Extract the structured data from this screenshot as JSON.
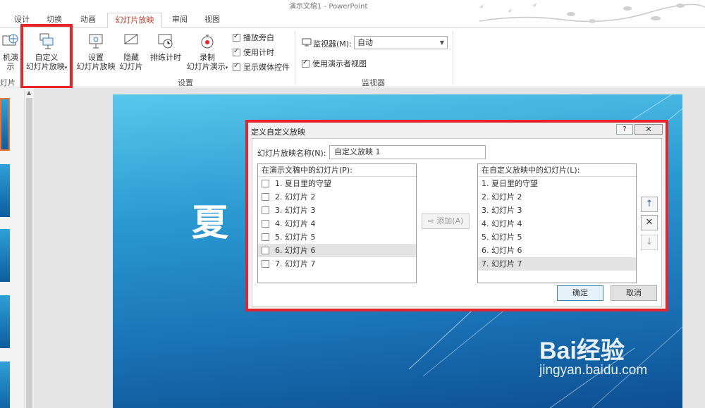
{
  "window": {
    "title": "演示文稿1 - PowerPoint"
  },
  "tabs": [
    {
      "label": "设计"
    },
    {
      "label": "切换"
    },
    {
      "label": "动画"
    },
    {
      "label": "幻灯片放映",
      "active": true
    },
    {
      "label": "审阅"
    },
    {
      "label": "视图"
    }
  ],
  "ribbon": {
    "online_btn_label": "机演示",
    "group_start_label": "灯片",
    "custom_show_btn": {
      "line1": "自定义",
      "line2": "幻灯片放映"
    },
    "setup_btn": {
      "line1": "设置",
      "line2": "幻灯片放映"
    },
    "hide_btn": {
      "line1": "隐藏",
      "line2": "幻灯片"
    },
    "rehearse_btn": {
      "line1": "排练计时"
    },
    "record_btn": {
      "line1": "录制",
      "line2": "幻灯片演示"
    },
    "checks": [
      {
        "label": "播放旁白",
        "checked": true
      },
      {
        "label": "使用计时",
        "checked": true
      },
      {
        "label": "显示媒体控件",
        "checked": true
      }
    ],
    "group_setup_label": "设置",
    "monitor_label": "监视器(M):",
    "monitor_value": "自动",
    "presenter_view_label": "使用演示者视图",
    "presenter_view_checked": true,
    "group_monitor_label": "监视器"
  },
  "slide": {
    "title_fragment": "夏",
    "watermark_big": "Bai经验",
    "watermark_small": "jingyan.baidu.com"
  },
  "dialog": {
    "title": "定义自定义放映",
    "help_glyph": "?",
    "close_glyph": "✕",
    "name_label": "幻灯片放映名称(N):",
    "name_value": "自定义放映 1",
    "left_list": {
      "header": "在演示文稿中的幻灯片(P):",
      "items": [
        {
          "label": "1. 夏日里的守望",
          "checked": false,
          "selected": false
        },
        {
          "label": "2. 幻灯片 2",
          "checked": false,
          "selected": false
        },
        {
          "label": "3. 幻灯片 3",
          "checked": false,
          "selected": false
        },
        {
          "label": "4. 幻灯片 4",
          "checked": false,
          "selected": false
        },
        {
          "label": "5. 幻灯片 5",
          "checked": false,
          "selected": false
        },
        {
          "label": "6. 幻灯片 6",
          "checked": false,
          "selected": true
        },
        {
          "label": "7. 幻灯片 7",
          "checked": false,
          "selected": false
        }
      ]
    },
    "add_button": "添加(A)",
    "right_list": {
      "header": "在自定义放映中的幻灯片(L):",
      "items": [
        {
          "label": "1. 夏日里的守望",
          "selected": false
        },
        {
          "label": "2. 幻灯片 2",
          "selected": false
        },
        {
          "label": "3. 幻灯片 3",
          "selected": false
        },
        {
          "label": "4. 幻灯片 4",
          "selected": false
        },
        {
          "label": "5. 幻灯片 5",
          "selected": false
        },
        {
          "label": "6. 幻灯片 6",
          "selected": false
        },
        {
          "label": "7. 幻灯片 7",
          "selected": true
        }
      ]
    },
    "move_up_glyph": "↑",
    "remove_glyph": "✕",
    "move_down_glyph": "↓",
    "ok_button": "确定",
    "cancel_button": "取消"
  },
  "colors": {
    "highlight": "#e8242b",
    "accent_tab": "#c0392b",
    "slide_blue": "#2a9ad2"
  }
}
